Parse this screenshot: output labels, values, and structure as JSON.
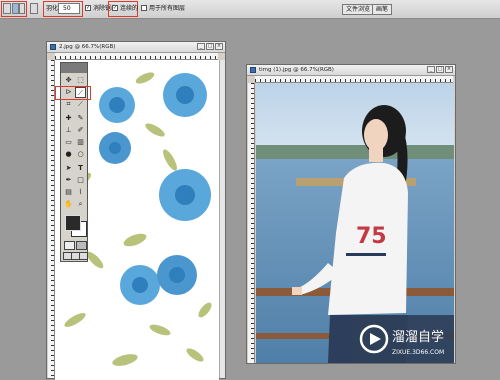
{
  "options_bar": {
    "feather_label": "羽化:",
    "feather_value": "50",
    "antialias_label": "消除锯齿",
    "contiguous_label": "连续的",
    "sample_all_label": "用于所有图层",
    "tabs": [
      "文件浏览",
      "画笔"
    ]
  },
  "doc_left": {
    "title": "2.jpg @ 66.7%(RGB)"
  },
  "doc_right": {
    "title": "timg (1).jpg @ 66.7%(RGB)"
  },
  "toolbox": {
    "tools": [
      "move-tool",
      "marquee-tool",
      "lasso-tool",
      "magic-wand-tool",
      "crop-tool",
      "slice-tool",
      "healing-tool",
      "brush-tool",
      "stamp-tool",
      "history-brush-tool",
      "eraser-tool",
      "gradient-tool",
      "blur-tool",
      "dodge-tool",
      "path-select-tool",
      "type-tool",
      "pen-tool",
      "shape-tool",
      "notes-tool",
      "eyedropper-tool",
      "hand-tool",
      "zoom-tool"
    ],
    "type_glyph": "T"
  },
  "watermark": {
    "name": "溜溜自学",
    "url": "ZIXUE.3D66.COM"
  },
  "colors": {
    "accent": "#e0382b",
    "flower": "#4a9ad4",
    "leaf": "#a8b56a",
    "sky": "#c9dcec",
    "sea": "#5e8fb7",
    "watermark_bg": "#2f3f59"
  }
}
